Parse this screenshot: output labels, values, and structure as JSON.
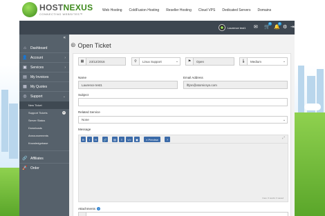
{
  "header": {
    "logo_main_a": "HOST",
    "logo_main_b": "NEXUS",
    "logo_sub": "CONNECTING WEBSITES™",
    "nav": [
      "Web Hosting",
      "ColdFusion Hosting",
      "Reseller Hosting",
      "Cloud VPS",
      "Dedicated Servers",
      "Domains"
    ]
  },
  "topbar": {
    "user_name": "Laurence test1",
    "cart_badge": "0",
    "notif_badge": "0",
    "icons": [
      "envelope-icon",
      "cart-icon",
      "bell-icon",
      "user-gear-icon",
      "logout-icon"
    ]
  },
  "sidebar": {
    "collapse_icon": "double-chevron-left-icon",
    "items": [
      {
        "label": "Dashboard",
        "icon": "home-icon"
      },
      {
        "label": "Account",
        "icon": "user-icon"
      },
      {
        "label": "Services",
        "icon": "cube-icon"
      },
      {
        "label": "My Invoices",
        "icon": "invoice-icon"
      },
      {
        "label": "My Quotes",
        "icon": "quote-icon"
      },
      {
        "label": "Support",
        "icon": "support-icon"
      }
    ],
    "support_sub": [
      "New Ticket",
      "Support Tickets",
      "Server Status",
      "Downloads",
      "Announcements",
      "Knowledgebase"
    ],
    "support_tickets_badge": "0",
    "bottom_items": [
      {
        "label": "Affiliates",
        "icon": "link-icon"
      },
      {
        "label": "Order",
        "icon": "rocket-icon"
      }
    ]
  },
  "main": {
    "title": "Open Ticket",
    "date": "23/12/2016",
    "department": "Linux Support",
    "status": "Open",
    "priority": "Medium",
    "name_label": "Name",
    "name_value": "Laurence test1",
    "email_label": "Email Address",
    "email_value": "lftjnn@atomicsys.com",
    "subject_label": "Subject",
    "subject_value": "",
    "related_label": "Related Service",
    "related_value": "None",
    "message_label": "Message",
    "toolbar": [
      "B",
      "I",
      "H",
      "🔗",
      "▤",
      "≡",
      "</>",
      "▣"
    ],
    "preview_label": "Preview",
    "editor_footer": "lines: 0   words: 0   saved",
    "attachments_label": "Attachments"
  },
  "colors": {
    "sidebar": "#56616b",
    "topbar": "#3d4650",
    "accent_green": "#3e8a1d",
    "button_blue": "#3b6aa8"
  }
}
